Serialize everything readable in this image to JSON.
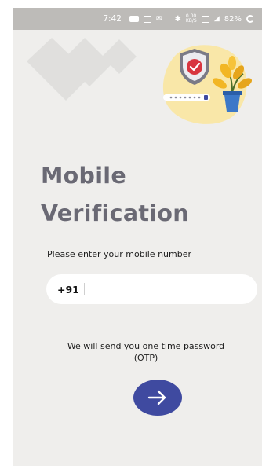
{
  "status_bar": {
    "time": "7:42",
    "network_speed": "0.00\nKB/S",
    "battery": "82%"
  },
  "icons": {
    "logo": "brand-logo-mark",
    "illustration": "security-shield-plant-illustration",
    "next": "arrow-right-icon"
  },
  "title": {
    "line1": "Mobile",
    "line2": "Verification"
  },
  "form": {
    "prompt": "Please enter your mobile number",
    "country_code": "+91",
    "phone_value": "",
    "phone_placeholder": ""
  },
  "otp_note": "We will send you one time password (OTP)",
  "colors": {
    "background": "#efeeec",
    "title": "#6a6974",
    "button": "#3f4aa0",
    "illustration_blob": "#f9e7a8"
  }
}
